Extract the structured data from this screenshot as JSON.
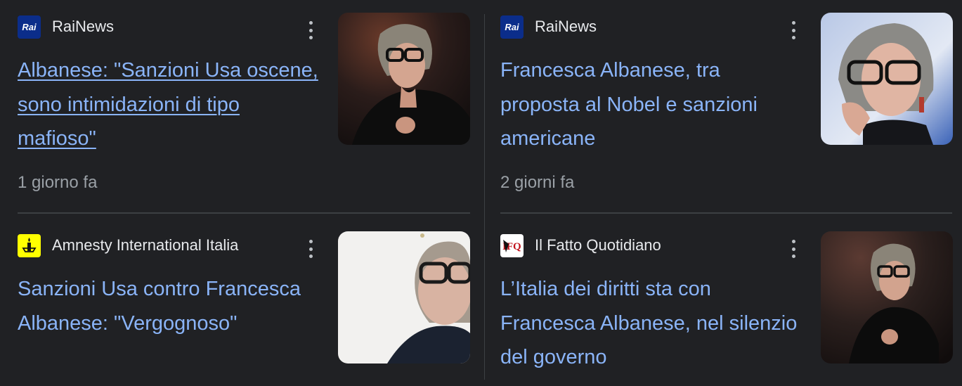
{
  "cards": [
    {
      "source": "RaiNews",
      "favicon": "rai-logo-icon",
      "favicon_text": "Rai",
      "headline": "Albanese: \"Sanzioni Usa oscene, sono intimidazioni di tipo mafioso\"",
      "timestamp": "1 giorno fa",
      "visited": true
    },
    {
      "source": "RaiNews",
      "favicon": "rai-logo-icon",
      "favicon_text": "Rai",
      "headline": "Francesca Albanese, tra proposta al Nobel e sanzioni americane",
      "timestamp": "2 giorni fa",
      "visited": false
    },
    {
      "source": "Amnesty International Italia",
      "favicon": "amnesty-candle-icon",
      "headline": "Sanzioni Usa contro Francesca Albanese: \"Vergognoso\"",
      "visited": false
    },
    {
      "source": "Il Fatto Quotidiano",
      "favicon": "ifq-logo-icon",
      "headline": "L’Italia dei diritti sta con Francesca Albanese, nel silenzio del governo",
      "visited": false
    }
  ],
  "colors": {
    "background": "#202124",
    "link": "#8ab4f8",
    "muted": "#9aa0a6",
    "divider": "#3c4043"
  }
}
